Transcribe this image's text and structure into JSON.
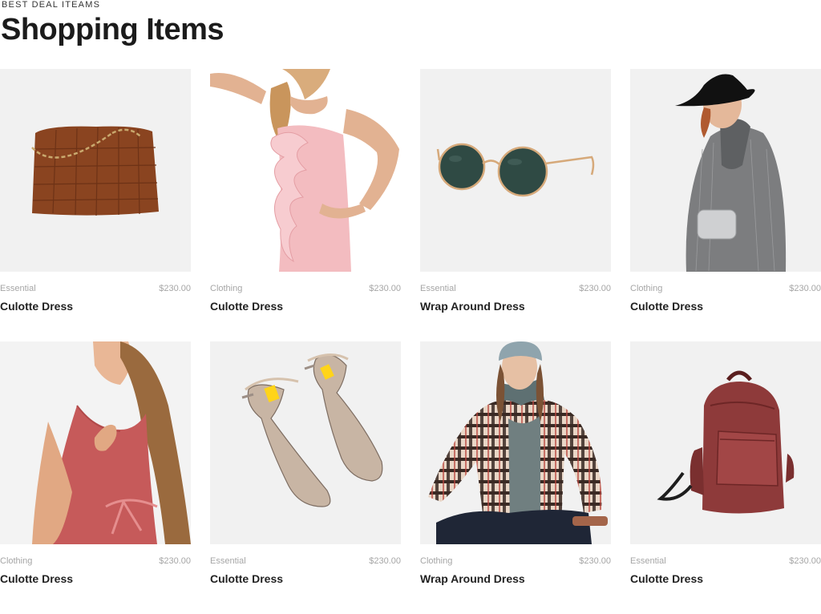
{
  "header": {
    "eyebrow": "BEST DEAL ITEAMS",
    "title": "Shopping Items"
  },
  "colors": {
    "thumb_bg": "#f1f1f1",
    "meta_text": "#a6a6a6",
    "title_text": "#1b1b1b"
  },
  "products": [
    {
      "category": "Essential",
      "price": "$230.00",
      "name": "Culotte Dress",
      "image": "leather-tote-bag-image"
    },
    {
      "category": "Clothing",
      "price": "$230.00",
      "name": "Culotte Dress",
      "image": "pink-ruffle-dress-image"
    },
    {
      "category": "Essential",
      "price": "$230.00",
      "name": "Wrap Around Dress",
      "image": "sunglasses-image"
    },
    {
      "category": "Clothing",
      "price": "$230.00",
      "name": "Culotte Dress",
      "image": "grey-blazer-hat-image"
    },
    {
      "category": "Clothing",
      "price": "$230.00",
      "name": "Culotte Dress",
      "image": "red-sleeveless-dress-image"
    },
    {
      "category": "Essential",
      "price": "$230.00",
      "name": "Culotte Dress",
      "image": "metallic-heels-image"
    },
    {
      "category": "Clothing",
      "price": "$230.00",
      "name": "Wrap Around Dress",
      "image": "plaid-shirt-beanie-image"
    },
    {
      "category": "Essential",
      "price": "$230.00",
      "name": "Culotte Dress",
      "image": "leather-backpack-image"
    }
  ]
}
